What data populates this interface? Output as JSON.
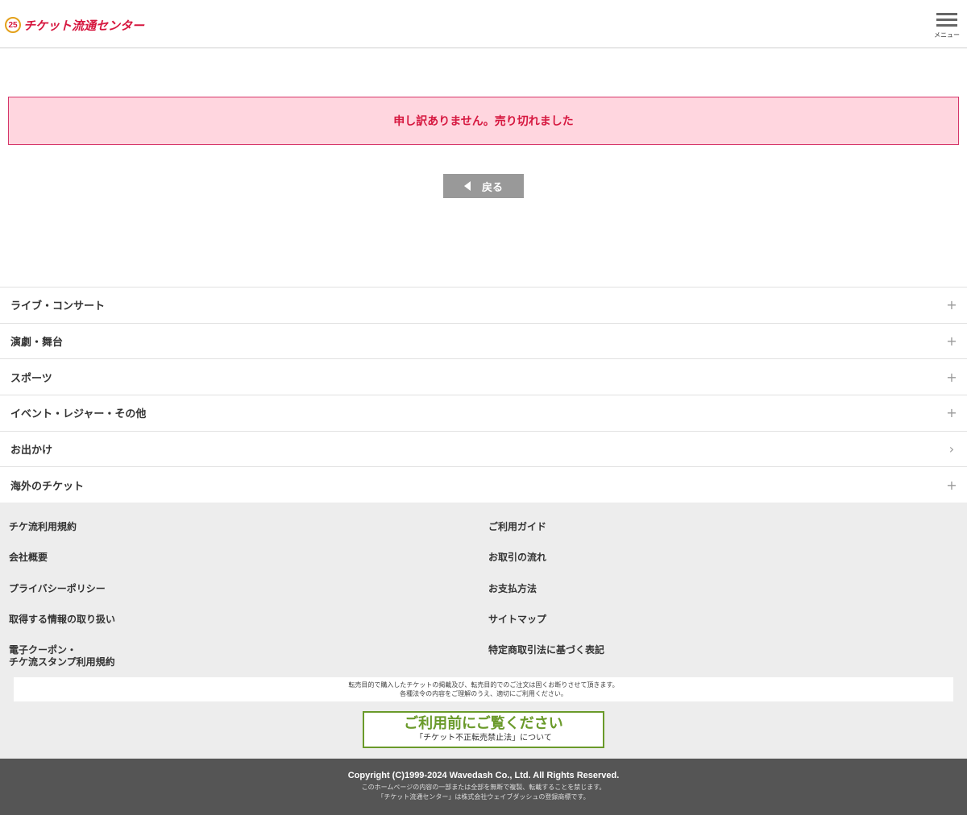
{
  "header": {
    "logo_badge": "25",
    "logo_text": "チケット流通センター",
    "menu_label": "メニュー"
  },
  "alert": {
    "message": "申し訳ありません。売り切れました"
  },
  "back_button": {
    "label": "戻る"
  },
  "categories": [
    {
      "label": "ライブ・コンサート",
      "icon": "plus-icon"
    },
    {
      "label": "演劇・舞台",
      "icon": "plus-icon"
    },
    {
      "label": "スポーツ",
      "icon": "plus-icon"
    },
    {
      "label": "イベント・レジャー・その他",
      "icon": "plus-icon"
    },
    {
      "label": "お出かけ",
      "icon": "chevron-right-icon"
    },
    {
      "label": "海外のチケット",
      "icon": "plus-icon"
    }
  ],
  "footer_links": {
    "left": [
      "チケ流利用規約",
      "会社概要",
      "プライバシーポリシー",
      "取得する情報の取り扱い",
      "電子クーポン・",
      "チケ流スタンプ利用規約"
    ],
    "right": [
      "ご利用ガイド",
      "お取引の流れ",
      "お支払方法",
      "サイトマップ",
      "特定商取引法に基づく表記"
    ]
  },
  "notice": {
    "line1": "転売目的で購入したチケットの掲載及び、転売目的でのご注文は固くお断りさせて頂きます。",
    "line2": "各種法令の内容をご理解のうえ、適切にご利用ください。"
  },
  "cta": {
    "title": "ご利用前にご覧ください",
    "subtitle": "「チケット不正転売禁止法」について"
  },
  "bottom": {
    "copyright": "Copyright (C)1999-2024 Wavedash Co., Ltd. All Rights Reserved.",
    "line1": "このホームページの内容の一部または全部を無断で複製、転載することを禁じます。",
    "line2": "「チケット流通センター」は株式会社ウェイブダッシュの登録商標です。"
  },
  "colors": {
    "brand": "#d6173f",
    "alert_bg": "#ffd6df",
    "cta_green": "#6a9a2a",
    "footer_bg": "#ededed",
    "bottom_bg": "#555555"
  }
}
